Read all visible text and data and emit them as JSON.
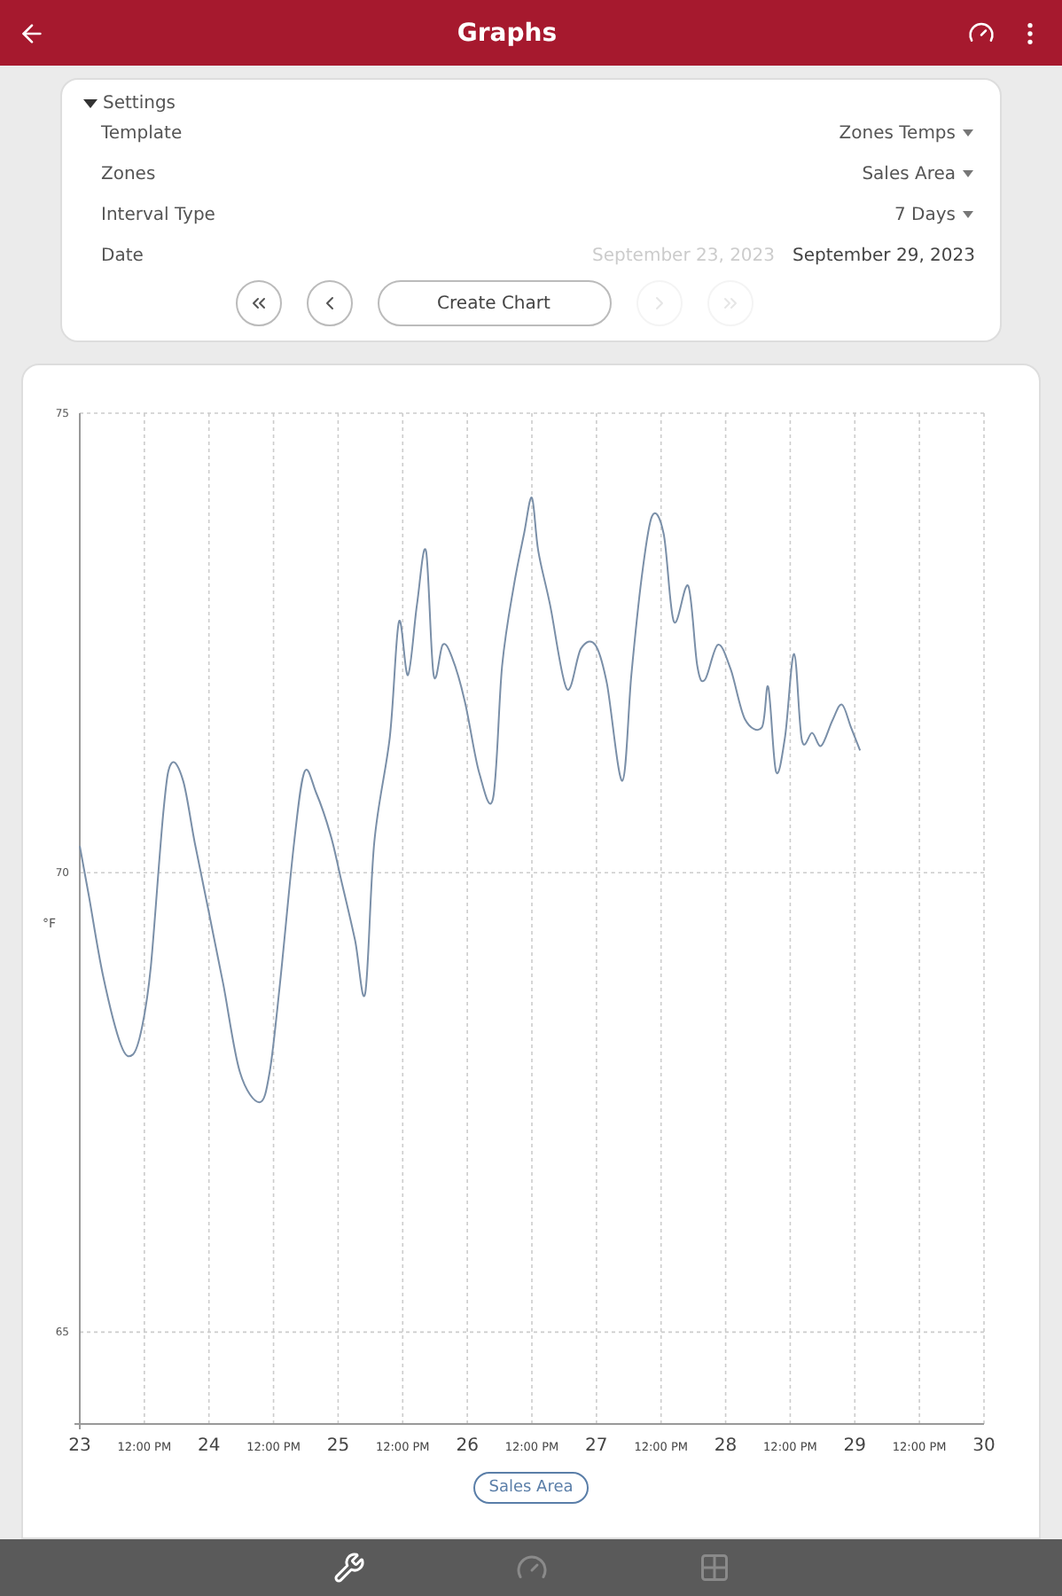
{
  "header": {
    "title": "Graphs"
  },
  "settings": {
    "title": "Settings",
    "expanded": true,
    "rows": [
      {
        "label": "Template",
        "value": "Zones Temps"
      },
      {
        "label": "Zones",
        "value": "Sales Area"
      },
      {
        "label": "Interval Type",
        "value": "7 Days"
      }
    ],
    "date": {
      "label": "Date",
      "start": "September 23, 2023",
      "start_disabled": true,
      "end": "September 29, 2023"
    },
    "nav_buttons": [
      {
        "kind": "first",
        "disabled": false
      },
      {
        "kind": "prev",
        "disabled": false
      },
      {
        "kind": "create",
        "label": "Create Chart",
        "disabled": false
      },
      {
        "kind": "next",
        "disabled": true
      },
      {
        "kind": "last",
        "disabled": true
      }
    ]
  },
  "chart": {
    "chart_data": {
      "type": "line",
      "ylabel": "°F",
      "xlim": [
        23,
        30
      ],
      "ylim": [
        64,
        75
      ],
      "yticks": [
        65,
        70,
        75
      ],
      "grid": true,
      "xticks": [
        23,
        24,
        25,
        26,
        27,
        28,
        29,
        30
      ],
      "annotations": [
        "12:00 PM",
        "12:00 PM",
        "12:00 PM",
        "12:00 PM",
        "12:00 PM",
        "12:00 PM",
        "12:00 PM"
      ],
      "x": [
        23.0,
        23.07,
        23.18,
        23.32,
        23.41,
        23.48,
        23.55,
        23.65,
        23.71,
        23.8,
        23.89,
        24.0,
        24.11,
        24.24,
        24.39,
        24.47,
        24.55,
        24.66,
        24.74,
        24.83,
        24.94,
        25.02,
        25.13,
        25.21,
        25.28,
        25.4,
        25.47,
        25.54,
        25.61,
        25.68,
        25.74,
        25.81,
        25.88,
        25.98,
        26.09,
        26.2,
        26.27,
        26.36,
        26.44,
        26.5,
        26.55,
        26.64,
        26.77,
        26.88,
        26.99,
        27.08,
        27.2,
        27.27,
        27.35,
        27.43,
        27.52,
        27.6,
        27.71,
        27.78,
        27.84,
        27.94,
        28.04,
        28.15,
        28.28,
        28.33,
        28.39,
        28.46,
        28.53,
        28.59,
        28.67,
        28.74,
        28.83,
        28.9,
        28.97,
        29.04
      ],
      "series": [
        {
          "name": "Sales Area",
          "color": "#7a8fa8",
          "values": [
            70.29,
            69.75,
            68.88,
            68.12,
            68.02,
            68.31,
            68.98,
            70.71,
            71.19,
            71.0,
            70.33,
            69.56,
            68.79,
            67.83,
            67.5,
            67.83,
            68.79,
            70.33,
            71.1,
            70.87,
            70.42,
            69.94,
            69.27,
            68.69,
            70.33,
            71.48,
            72.73,
            72.15,
            72.92,
            73.5,
            72.15,
            72.48,
            72.35,
            71.87,
            71.1,
            70.81,
            72.25,
            73.12,
            73.69,
            74.08,
            73.5,
            72.92,
            72.0,
            72.44,
            72.48,
            72.06,
            71.0,
            72.15,
            73.21,
            73.88,
            73.69,
            72.73,
            73.12,
            72.25,
            72.1,
            72.48,
            72.21,
            71.67,
            71.58,
            72.02,
            71.1,
            71.48,
            72.38,
            71.44,
            71.52,
            71.38,
            71.67,
            71.83,
            71.58,
            71.33
          ]
        }
      ]
    }
  },
  "bottom_nav": [
    {
      "kind": "tools",
      "selected": true
    },
    {
      "kind": "gauge",
      "selected": false
    },
    {
      "kind": "apps",
      "selected": false
    }
  ]
}
